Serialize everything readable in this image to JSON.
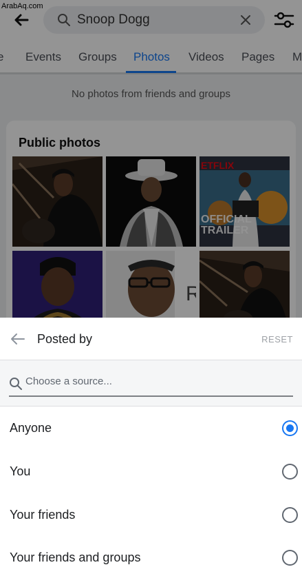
{
  "watermark": "ArabAq.com",
  "search": {
    "query": "Snoop Dogg"
  },
  "tabs": [
    {
      "label": "e"
    },
    {
      "label": "Events"
    },
    {
      "label": "Groups"
    },
    {
      "label": "Photos",
      "active": true
    },
    {
      "label": "Videos"
    },
    {
      "label": "Pages"
    },
    {
      "label": "M"
    }
  ],
  "notice": "No photos from friends and groups",
  "public_photos": {
    "title": "Public photos",
    "thumb3_overlay": {
      "top": "ETFLIX",
      "bottom_1": "OFFICIAL",
      "bottom_2": "TRAILER"
    },
    "thumb5_letter": "R"
  },
  "sheet": {
    "title": "Posted by",
    "reset_label": "RESET",
    "source_placeholder": "Choose a source...",
    "options": [
      {
        "label": "Anyone",
        "selected": true
      },
      {
        "label": "You",
        "selected": false
      },
      {
        "label": "Your friends",
        "selected": false
      },
      {
        "label": "Your friends and groups",
        "selected": false
      }
    ]
  },
  "colors": {
    "accent": "#1877f2",
    "netflix_red": "#e50914"
  }
}
